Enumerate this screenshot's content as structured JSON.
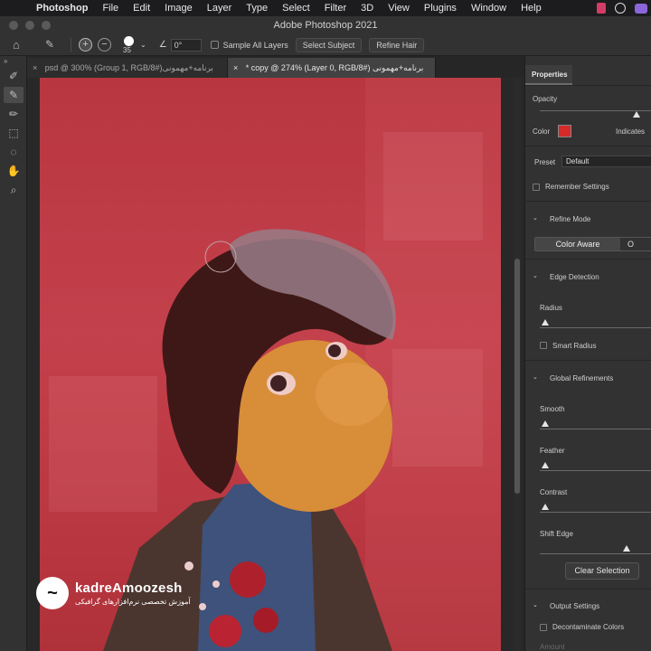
{
  "menubar": {
    "app": "Photoshop",
    "items": [
      "File",
      "Edit",
      "Image",
      "Layer",
      "Type",
      "Select",
      "Filter",
      "3D",
      "View",
      "Plugins",
      "Window",
      "Help"
    ]
  },
  "window": {
    "title": "Adobe Photoshop 2021"
  },
  "options": {
    "brush_size": "35",
    "angle": "0°",
    "sample_all_layers": "Sample All Layers",
    "select_subject": "Select Subject",
    "refine_hair": "Refine Hair"
  },
  "tabs": [
    {
      "label": "psd @ 300% (Group 1, RGB/8#)برنامه+مهمونی",
      "close": "×"
    },
    {
      "label": "* copy @ 274% (Layer 0, RGB/8#) برنامه+مهمونی",
      "close": "×"
    }
  ],
  "tools": [
    "quick-selection",
    "refine-edge-brush",
    "brush",
    "object-selection",
    "lasso",
    "hand",
    "zoom"
  ],
  "properties": {
    "title": "Properties",
    "opacity_label": "Opacity",
    "opacity_value": 0.86,
    "color_label": "Color",
    "color_value": "#d42a2a",
    "indicates_label": "Indicates",
    "preset_label": "Preset",
    "preset_value": "Default",
    "remember_settings": "Remember Settings",
    "refine_mode": "Refine Mode",
    "color_aware": "Color Aware",
    "object_aware_partial": "O",
    "edge_detection": "Edge Detection",
    "radius": "Radius",
    "smart_radius": "Smart Radius",
    "global_refinements": "Global Refinements",
    "smooth": "Smooth",
    "feather": "Feather",
    "contrast": "Contrast",
    "shift_edge": "Shift Edge",
    "clear_selection": "Clear Selection",
    "output_settings": "Output Settings",
    "decontaminate_colors": "Decontaminate Colors",
    "amount": "Amount"
  },
  "watermark": {
    "title": "kadreAmoozesh",
    "subtitle": "آموزش تخصصی نرم‌افزارهای گرافیکی"
  }
}
